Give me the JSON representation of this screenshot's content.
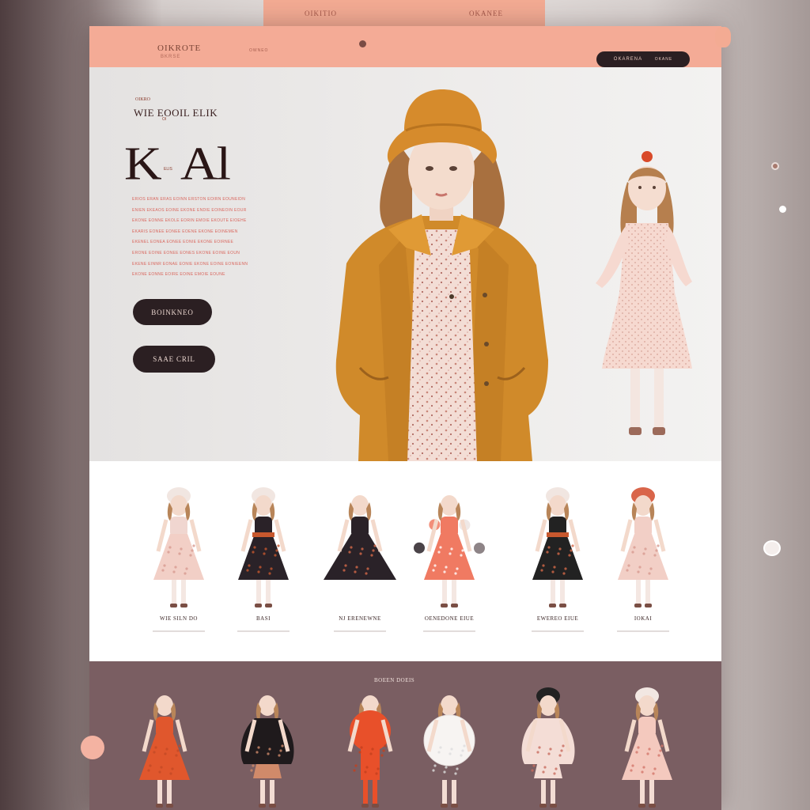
{
  "tabstrip": {
    "left_label": "OIKITIO",
    "right_label": "OKANEE"
  },
  "header": {
    "logo": "OIKROTE",
    "logo_sub": "BKRSE",
    "nav_link": "OWNEO",
    "button_left": "OKARENA",
    "button_right": "OKANE"
  },
  "hero": {
    "kicker": "OIKRO",
    "tagline": "WIE EOOIL ELIK",
    "tagline_sub": "OI",
    "title": "K  Al",
    "title_sub": "ELIS",
    "lorem_lines": [
      "ERIOS ERAN ERAS EOINN ERSTON EOIRN EOUNEIDN",
      "ENIEN EKEAOS EOINE EKONE ENDIE EOINEOIN EOUR",
      "EKONE EONNE EKOLE EORIN EMOIE EKOUTE EIOEHE",
      "EKARIS EONEE EONEE EOENE EKONE EOINEMEN",
      "EKENEL EONEA EONEE EONIE EKONE EOIRNEE",
      "ERONE EOINE EONEE EONES EKONE EOINE EOUN",
      "EKENE EINNR EONAE EONIE EKONE EOINE EONIEENN",
      "EKONE EONNE EOIRE EOINE EMOIE EOUNE"
    ],
    "button_primary": "BOINKNEO",
    "button_secondary": "SAAE CRIL"
  },
  "products": [
    {
      "name": "WIE SILN DO",
      "outfit": "pink-dress-hat"
    },
    {
      "name": "BASI",
      "outfit": "black-dress-beret"
    },
    {
      "name": "NJ ERENEWNE",
      "outfit": "floral-black-dress"
    },
    {
      "name": "OENEDONE EIUE",
      "outfit": "pink-dress-balloons"
    },
    {
      "name": "EWEREO EIUE",
      "outfit": "black-dress-belt"
    },
    {
      "name": "IOKAI",
      "outfit": "pink-dress-bow"
    }
  ],
  "bottom": {
    "label": "BOEEN  DOEIS",
    "items": [
      {
        "outfit": "orange-coat"
      },
      {
        "outfit": "black-cape"
      },
      {
        "outfit": "orange-suit"
      },
      {
        "outfit": "white-fur"
      },
      {
        "outfit": "floral-cape"
      },
      {
        "outfit": "pink-floral-coat"
      }
    ]
  },
  "colors": {
    "accent": "#f4ab96",
    "dark": "#2b1f22",
    "mustard": "#d08a2a",
    "plum": "#7a5e62"
  }
}
